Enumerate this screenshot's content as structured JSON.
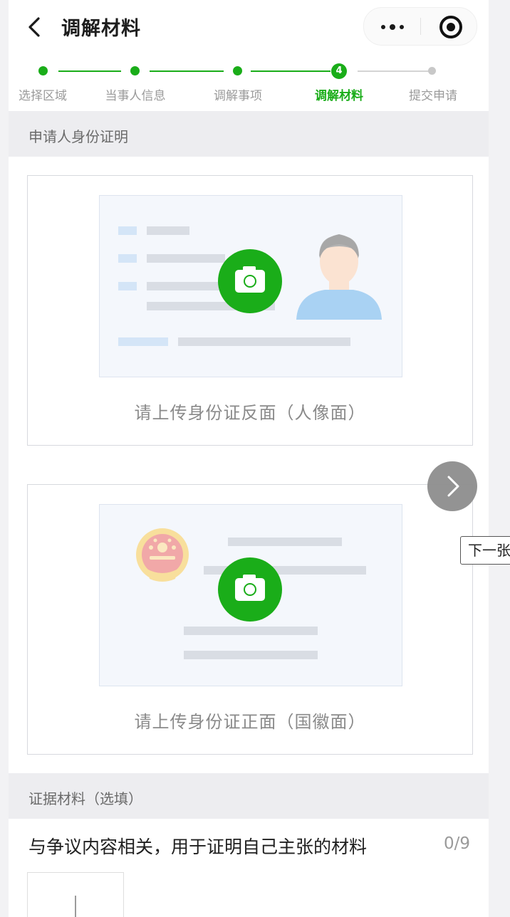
{
  "navbar": {
    "title": "调解材料",
    "back_icon": "chevron-left-icon",
    "more_icon": "more-dots-icon",
    "close_icon": "target-close-icon"
  },
  "steps": [
    {
      "label": "选择区域",
      "state": "done"
    },
    {
      "label": "当事人信息",
      "state": "done"
    },
    {
      "label": "调解事项",
      "state": "done"
    },
    {
      "label": "调解材料",
      "state": "current",
      "number": "4"
    },
    {
      "label": "提交申请",
      "state": "todo"
    }
  ],
  "colors": {
    "accent": "#1aad19",
    "inactive": "#c8c8c8"
  },
  "identity_section": {
    "header": "申请人身份证明",
    "cards": [
      {
        "caption": "请上传身份证反面（人像面）",
        "icon": "camera-icon"
      },
      {
        "caption": "请上传身份证正面（国徽面）",
        "icon": "camera-icon"
      }
    ]
  },
  "evidence_section": {
    "header": "证据材料（选填）",
    "description": "与争议内容相关，用于证明自己主张的材料",
    "count": "0/9"
  },
  "next": {
    "icon": "chevron-right-icon",
    "label": "下一张"
  }
}
